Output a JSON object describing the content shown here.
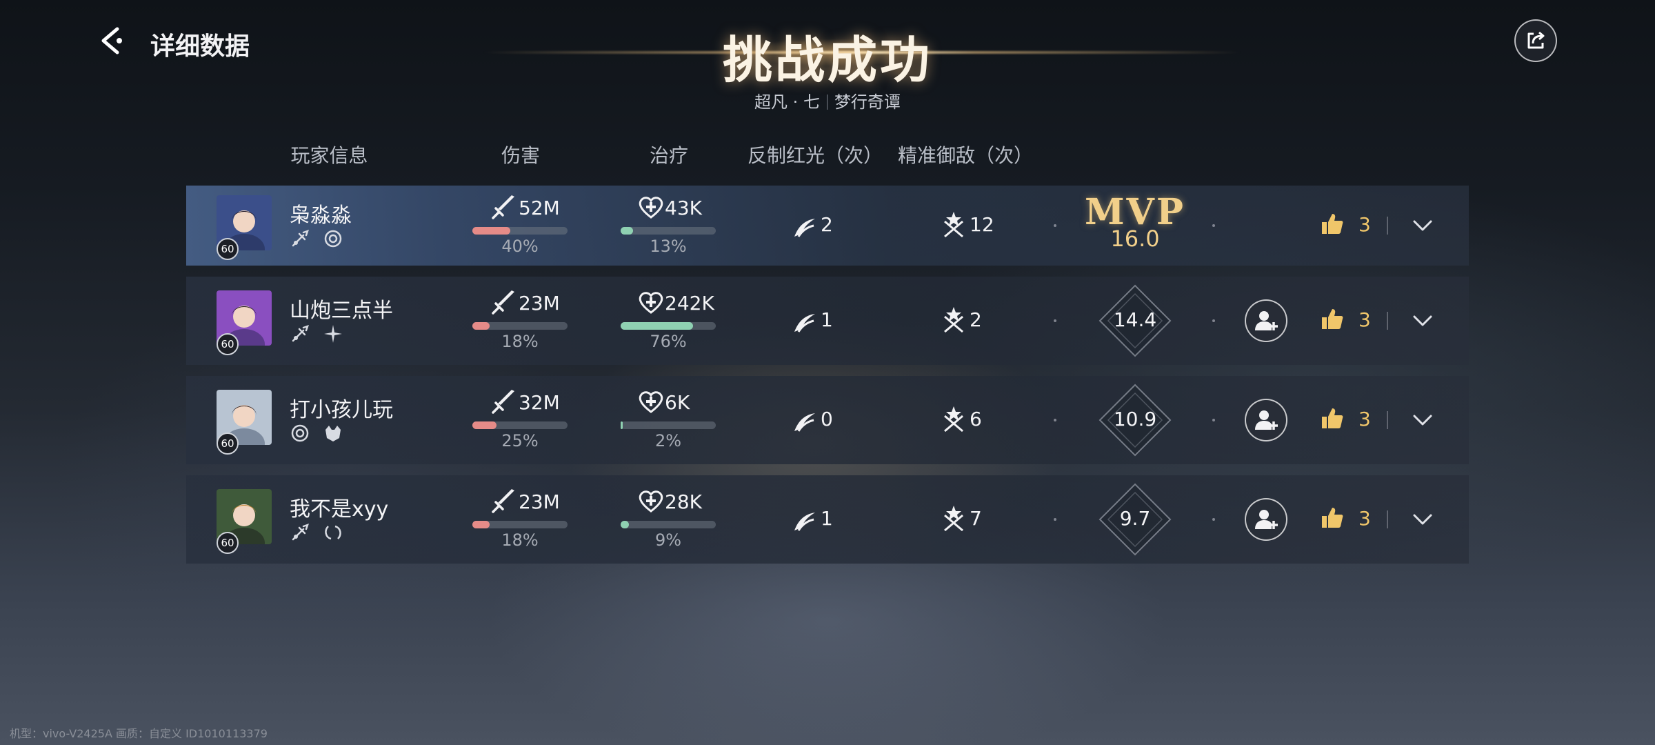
{
  "header": {
    "page_label": "详细数据",
    "title": "挑战成功",
    "subtitle_left": "超凡 · 七",
    "subtitle_right": "梦行奇谭"
  },
  "columns": [
    "玩家信息",
    "伤害",
    "治疗",
    "反制红光（次）",
    "精准御敌（次）"
  ],
  "players": [
    {
      "name": "枭淼淼",
      "level": "60",
      "damage": "52M",
      "damage_pct": "40%",
      "damage_frac": 0.4,
      "heal": "43K",
      "heal_pct": "13%",
      "heal_frac": 0.13,
      "counter": "2",
      "parry": "12",
      "mvp_label": "MVP",
      "score": "16.0",
      "likes": "3",
      "is_mvp": true
    },
    {
      "name": "山炮三点半",
      "level": "60",
      "damage": "23M",
      "damage_pct": "18%",
      "damage_frac": 0.18,
      "heal": "242K",
      "heal_pct": "76%",
      "heal_frac": 0.76,
      "counter": "1",
      "parry": "2",
      "score": "14.4",
      "likes": "3",
      "is_mvp": false
    },
    {
      "name": "打小孩儿玩",
      "level": "60",
      "damage": "32M",
      "damage_pct": "25%",
      "damage_frac": 0.25,
      "heal": "6K",
      "heal_pct": "2%",
      "heal_frac": 0.02,
      "counter": "0",
      "parry": "6",
      "score": "10.9",
      "likes": "3",
      "is_mvp": false
    },
    {
      "name": "我不是xyy",
      "level": "60",
      "damage": "23M",
      "damage_pct": "18%",
      "damage_frac": 0.18,
      "heal": "28K",
      "heal_pct": "9%",
      "heal_frac": 0.09,
      "counter": "1",
      "parry": "7",
      "score": "9.7",
      "likes": "3",
      "is_mvp": false
    }
  ],
  "colors": {
    "damage_bar": "#e58b88",
    "heal_bar": "#8fd1b2",
    "mvp_gold": "#f1cf8a",
    "like": "#f0c66a"
  },
  "icons": {
    "back": "back-arrow-icon",
    "share": "share-icon",
    "damage": "sword-icon",
    "heal": "heart-plus-icon",
    "counter": "counter-slash-icon",
    "parry": "crossed-swords-star-icon",
    "add_friend": "add-friend-icon",
    "like": "thumbs-up-icon",
    "expand": "chevron-down-icon"
  },
  "footer": {
    "device_info": "机型：vivo-V2425A 画质：自定义 ID1010113379"
  }
}
